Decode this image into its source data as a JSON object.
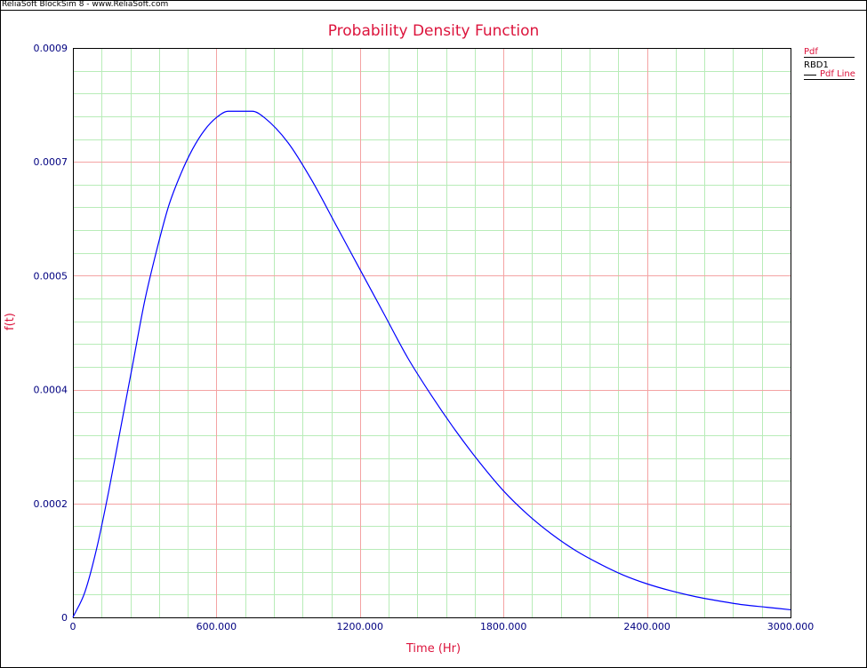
{
  "app": {
    "window_title": "ReliaSoft BlockSim 8 - www.ReliaSoft.com"
  },
  "legend": {
    "header": "Pdf",
    "group": "RBD1",
    "line_label": "Pdf Line"
  },
  "colors": {
    "title": "#dc143c",
    "axis_tick_text": "#000080",
    "major_grid": "#f4a3a3",
    "minor_grid": "#b8ecb8",
    "curve": "#0000ff"
  },
  "chart_data": {
    "type": "line",
    "title": "Probability Density Function",
    "xlabel": "Time (Hr)",
    "ylabel": "f(t)",
    "xlim": [
      0,
      3000
    ],
    "ylim": [
      0,
      0.0009
    ],
    "x_ticks": [
      "0",
      "600.000",
      "1200.000",
      "1800.000",
      "2400.000",
      "3000.000"
    ],
    "y_ticks": [
      "0",
      "0.0002",
      "0.0004",
      "0.0005",
      "0.0007",
      "0.0009"
    ],
    "y_tick_values": [
      0,
      0.00018,
      0.00036,
      0.00054,
      0.00072,
      0.0009
    ],
    "grid": true,
    "legend_position": "right",
    "series": [
      {
        "name": "Pdf Line",
        "x": [
          0,
          50,
          100,
          150,
          200,
          250,
          300,
          350,
          400,
          450,
          500,
          550,
          600,
          650,
          700,
          750,
          800,
          900,
          1000,
          1100,
          1200,
          1300,
          1400,
          1500,
          1600,
          1700,
          1800,
          1900,
          2000,
          2100,
          2200,
          2300,
          2400,
          2500,
          2600,
          2700,
          2800,
          2900,
          3000
        ],
        "y": [
          0,
          4e-05,
          0.00011,
          0.0002,
          0.0003,
          0.0004,
          0.0005,
          0.00058,
          0.00065,
          0.0007,
          0.00074,
          0.00077,
          0.00079,
          0.0008,
          0.0008,
          0.0008,
          0.00079,
          0.00075,
          0.00069,
          0.00062,
          0.00055,
          0.00048,
          0.00041,
          0.00035,
          0.000295,
          0.000245,
          0.0002,
          0.000163,
          0.000132,
          0.000106,
          8.5e-05,
          6.7e-05,
          5.3e-05,
          4.2e-05,
          3.3e-05,
          2.6e-05,
          2e-05,
          1.6e-05,
          1.2e-05
        ]
      }
    ]
  }
}
